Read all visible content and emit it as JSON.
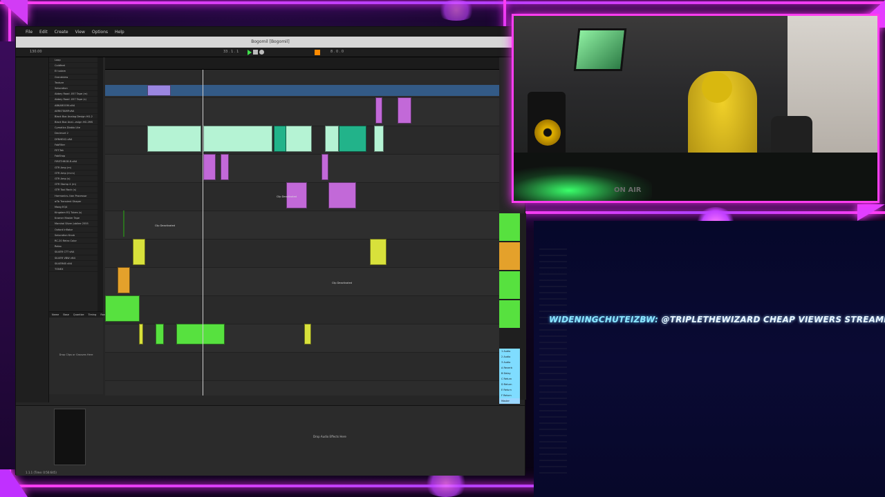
{
  "daw": {
    "menu": [
      "File",
      "Edit",
      "Create",
      "View",
      "Options",
      "Help"
    ],
    "title": "Bogomil [Bogomil]",
    "browser_items": [
      "Loop",
      "Coldfeet",
      "El tudam",
      "Grandview",
      "Texture",
      "Saturation",
      "Abbey Road .057 Tape (m)",
      "Abbey Road .057 Tape (s)",
      "ABKAROOM.vN4",
      "AERIOTAMP.vN4",
      "Black Box Analog Design HG-2",
      "Black Box Anal...esign HG-2MS",
      "Cymatics Diablo Lite",
      "Decimort 2",
      "DYNHEX2.vN4",
      "FabFilter",
      "FET-Tek",
      "FabShop",
      "FIRETHROB.R.vN4",
      "GTR Amp (m)",
      "GTR Amp (m>s)",
      "GTR Amp (s)",
      "GTR Stomp 4 (m)",
      "GTR Tool Rack (s)",
      "Harmonics..tion Processor",
      "aiTa Transient Shaper",
      "Maag EQ4",
      "Kingdam EQ Tubes (s)",
      "Kramer Master Tape",
      "Marshal Silver Jubilee 2555",
      "Oxford Inflator",
      "Saturation Knob",
      "RC-20 Retro Color",
      "Relax",
      "SILVER CTT vN4",
      "SILVER VBW vN4",
      "SILVERVB vN4",
      "TONEX"
    ],
    "groove_headers": [
      "Name",
      "Base",
      "Quantize",
      "Timing",
      "Random",
      "Velocity"
    ],
    "groove_hint": "Drop Clips or Grooves Here",
    "drop_effects": "Drop Audio Effects Here",
    "clip_deactivated": "Clip Deactivated",
    "clip_label_a": "Tri Bit",
    "clip_label_b": "1 Bit",
    "status_bar": "1.1.1 (Time: 0:56:645)",
    "tempo": "130.00",
    "position": "33 . 1 . 1",
    "loop_length": "8 . 0 . 0"
  },
  "mixer": {
    "tracks": [
      "1 Audio",
      "2 Audio",
      "3 Audio",
      "A Reverb",
      "B Delay",
      "C Return",
      "D Return",
      "E Return",
      "F Return",
      "Master"
    ]
  },
  "chat": {
    "username": "WIDENINGCHUTEIZBW:",
    "message": "@TRIPLETHEWIZARD CHEAP VIEWERS STREAMBOO .COM (R"
  },
  "webcam": {
    "sign": "ON AIR"
  },
  "colors": {
    "neon_pink": "#ff3df0",
    "neon_purple": "#b040ff",
    "clip_mint": "#b5f3d4",
    "clip_teal": "#22b38a",
    "clip_violet": "#c269d8",
    "clip_green": "#57e13f",
    "clip_yellow": "#d8e13b",
    "clip_orange": "#e4a12b",
    "clip_lavender": "#9a86e0",
    "chat_username": "#8be6ff"
  },
  "icons": [
    "play-icon",
    "stop-icon",
    "record-icon",
    "folder-icon",
    "close-icon"
  ]
}
